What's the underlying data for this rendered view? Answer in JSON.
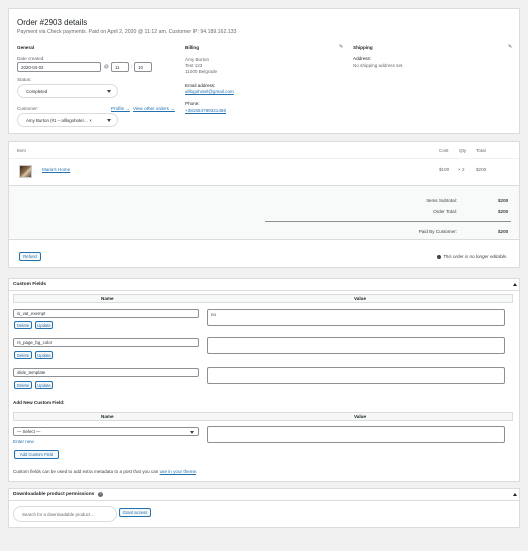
{
  "order": {
    "title": "Order #2903 details",
    "subtitle": "Payment via Check payments. Paid on April 2, 2020 @ 11:12 am. Customer IP: 94.189.162.133"
  },
  "general": {
    "heading": "General",
    "date_label": "Date created:",
    "date_value": "2020-04-02",
    "at": "@",
    "hour": "11",
    "minute": "10",
    "status_label": "Status:",
    "status_value": "Completed",
    "customer_label": "Customer:",
    "profile_link": "Profile →",
    "other_orders_link": "View other orders →",
    "customer_value": "Amy Burton (#1 – alllogohotel… ×"
  },
  "billing": {
    "heading": "Billing",
    "address_lines": [
      "Amy Burton",
      "Test 123",
      "11000 Belgrade"
    ],
    "email_label": "Email address:",
    "email": "alllogohotel@gmail.com",
    "phone_label": "Phone:",
    "phone": "+381654789321456"
  },
  "shipping": {
    "heading": "Shipping",
    "address_label": "Address:",
    "address_value": "No shipping address set."
  },
  "items": {
    "col_item": "Item",
    "col_cost": "Cost",
    "col_qty": "Qty",
    "col_total": "Total",
    "rows": [
      {
        "name": "Maria's Home",
        "cost": "$100",
        "qty": "× 2",
        "total": "$200"
      }
    ]
  },
  "totals": {
    "subtotal_label": "Items Subtotal:",
    "subtotal": "$200",
    "order_total_label": "Order Total:",
    "order_total": "$200",
    "paid_label": "Paid By Customer:",
    "paid": "$200"
  },
  "refund": {
    "button": "Refund",
    "note": "This order is no longer editable."
  },
  "custom_fields": {
    "title": "Custom Fields",
    "col_name": "Name",
    "col_value": "Value",
    "delete": "Delete",
    "update": "Update",
    "rows": [
      {
        "name": "is_vat_exempt",
        "value": "no"
      },
      {
        "name": "rs_page_bg_color",
        "value": ""
      },
      {
        "name": "slide_template",
        "value": ""
      }
    ],
    "add_heading": "Add New Custom Field:",
    "select_placeholder": "— Select —",
    "enter_new": "Enter new",
    "add_button": "Add Custom Field",
    "footer_text": "Custom fields can be used to add extra metadata to a post that you can ",
    "footer_link": "use in your theme",
    "footer_end": "."
  },
  "downloads": {
    "title": "Downloadable product permissions",
    "search_placeholder": "Search for a downloadable product…",
    "grant_button": "Grant access"
  },
  "colors": {
    "link": "#2271b1",
    "background": "#f1f1f1",
    "panel_border": "#dcdcde"
  }
}
